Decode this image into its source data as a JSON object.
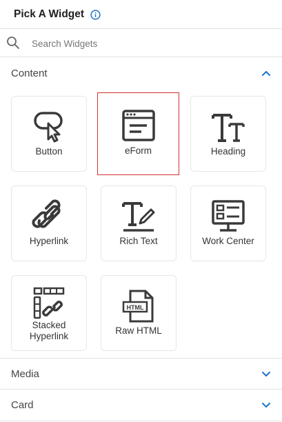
{
  "header": {
    "title": "Pick A Widget",
    "info_icon": "info-icon"
  },
  "search": {
    "placeholder": "Search Widgets",
    "value": "",
    "icon": "search-icon"
  },
  "sections": {
    "content": {
      "label": "Content",
      "expanded": true,
      "chevron": "chevron-up-icon"
    },
    "media": {
      "label": "Media",
      "expanded": false,
      "chevron": "chevron-down-icon"
    },
    "card": {
      "label": "Card",
      "expanded": false,
      "chevron": "chevron-down-icon"
    }
  },
  "widgets": [
    {
      "label": "Button",
      "icon": "cursor-pointer-icon",
      "selected": false
    },
    {
      "label": "eForm",
      "icon": "form-window-icon",
      "selected": true
    },
    {
      "label": "Heading",
      "icon": "text-size-icon",
      "selected": false
    },
    {
      "label": "Hyperlink",
      "icon": "link-icon",
      "selected": false
    },
    {
      "label": "Rich Text",
      "icon": "text-edit-icon",
      "selected": false
    },
    {
      "label": "Work Center",
      "icon": "dashboard-monitor-icon",
      "selected": false
    },
    {
      "label": "Stacked Hyperlink",
      "label_lines": [
        "Stacked",
        "Hyperlink"
      ],
      "icon": "stacked-link-icon",
      "selected": false
    },
    {
      "label": "Raw HTML",
      "icon": "html-file-icon",
      "selected": false,
      "icon_text": "HTML"
    }
  ],
  "colors": {
    "accent": "#1a73c8",
    "selected_border": "#d32f2f",
    "icon": "#3a3a3a"
  }
}
